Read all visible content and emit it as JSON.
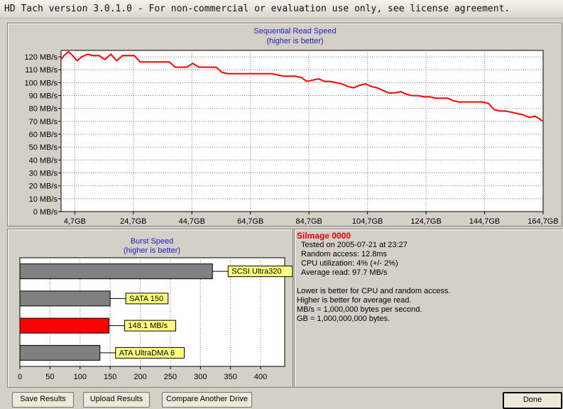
{
  "window": {
    "title": "HD Tach version 3.0.1.0  - For non-commercial or evaluation use only, see license agreement."
  },
  "chart_data": [
    {
      "type": "line",
      "title": "Sequential Read Speed",
      "subtitle": "(higher is better)",
      "ylim": [
        0,
        125
      ],
      "yticks": [
        0,
        10,
        20,
        30,
        40,
        50,
        60,
        70,
        80,
        90,
        100,
        110,
        120
      ],
      "ytick_labels": [
        "0 MB/s",
        "10 MB/s",
        "20 MB/s",
        "30 MB/s",
        "40 MB/s",
        "50 MB/s",
        "60 MB/s",
        "70 MB/s",
        "80 MB/s",
        "90 MB/s",
        "100 MB/s",
        "110 MB/s",
        "120 MB/s"
      ],
      "xlim": [
        0,
        164.7
      ],
      "xticks": [
        4.7,
        24.7,
        44.7,
        64.7,
        84.7,
        104.7,
        124.7,
        144.7,
        164.7
      ],
      "xtick_labels": [
        "4,7GB",
        "24,7GB",
        "44,7GB",
        "64,7GB",
        "84,7GB",
        "104,7GB",
        "124,7GB",
        "144,7GB",
        "164,7GB"
      ],
      "grid": true,
      "color": "#ff0000",
      "x": [
        0,
        1,
        2.5,
        4,
        5.5,
        7,
        9,
        11,
        13,
        15,
        17,
        19,
        21,
        23,
        25,
        27,
        29,
        33,
        35,
        37,
        39,
        41,
        43,
        45,
        47,
        49,
        51,
        53,
        55,
        57,
        60,
        62,
        64,
        66,
        68,
        70,
        72,
        74,
        76,
        78,
        80,
        82,
        84,
        86,
        88,
        90,
        92,
        94,
        96,
        98,
        100,
        102,
        104,
        106,
        108,
        110,
        112,
        114,
        116,
        118,
        120,
        122,
        124,
        126,
        128,
        130,
        132,
        134,
        136,
        138,
        140,
        142,
        144,
        146,
        148,
        150,
        152,
        154,
        156,
        158,
        160,
        162,
        164.7
      ],
      "y": [
        118,
        121,
        124,
        121,
        117,
        120,
        122,
        121,
        121,
        118,
        122,
        117,
        121,
        121,
        121,
        116,
        116,
        116,
        116,
        116,
        112,
        112,
        112,
        115,
        112,
        112,
        112,
        112,
        108,
        107,
        107,
        107,
        107,
        107,
        107,
        107,
        107,
        106,
        105,
        105,
        105,
        104,
        101,
        102,
        103,
        101,
        101,
        100,
        99,
        97,
        96,
        98,
        99,
        97,
        96,
        94,
        92,
        92,
        93,
        91,
        90,
        90,
        89,
        89,
        88,
        88,
        88,
        86,
        85,
        85,
        85,
        85,
        85,
        84,
        79,
        78,
        78,
        77,
        76,
        75,
        73,
        74,
        70,
        68,
        66,
        63,
        62,
        61,
        60
      ],
      "label": "chart-seq"
    },
    {
      "type": "bar",
      "title": "Burst Speed",
      "subtitle": "(higher is better)",
      "categories": [
        "SCSI Ultra320",
        "SATA 150",
        "148.1 MB/s",
        "ATA UltraDMA 6"
      ],
      "values": [
        320,
        150,
        148.1,
        133
      ],
      "colors": [
        "#808080",
        "#808080",
        "#ff0000",
        "#808080"
      ],
      "xlim": [
        0,
        440
      ],
      "xticks": [
        0,
        50,
        100,
        150,
        200,
        250,
        300,
        350,
        400
      ],
      "xtick_labels": [
        "0",
        "50",
        "100",
        "150",
        "200",
        "250",
        "300",
        "350",
        "400"
      ],
      "grid": true
    }
  ],
  "info": {
    "drive": "Silmage 0000",
    "tested": "Tested on 2005-07-21 at 23:27",
    "random_access": "Random access: 12.8ms",
    "cpu": "CPU utilization: 4% (+/- 2%)",
    "avg_read": "Average read: 97.7 MB/s",
    "note1": "Lower is better for CPU and random access.",
    "note2": "Higher is better for average read.",
    "note3": "MB/s = 1,000,000 bytes per second.",
    "note4": "GB = 1,000,000,000 bytes."
  },
  "buttons": {
    "save": "Save Results",
    "upload": "Upload Results",
    "compare": "Compare Another Drive",
    "done": "Done"
  }
}
